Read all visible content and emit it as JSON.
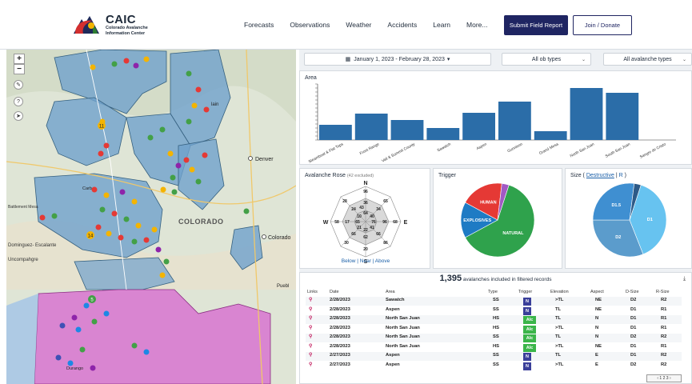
{
  "header": {
    "brand": "CAIC",
    "brand_sub": "Colorado Avalanche Information Center",
    "nav": [
      "Forecasts",
      "Observations",
      "Weather",
      "Accidents",
      "Learn",
      "More..."
    ],
    "submit_label": "Submit Field Report",
    "donate_label": "Join / Donate"
  },
  "map": {
    "zoom_in": "+",
    "zoom_out": "−",
    "labels": {
      "colorado": "COLORADO",
      "denver": "Denver",
      "co_springs": "Colorado",
      "pueblo": "Puebl",
      "battlement": "Battlement Mesa",
      "dominguez": "Dominguez-\nEscalante",
      "uncompahgre": "Uncompahgre",
      "durango": "Durango",
      "rifle": "Carb",
      "lain": "lain"
    },
    "colors": {
      "zone": "#6fa1cc",
      "south": "#d86fcf",
      "dot_red": "#e53935",
      "dot_yellow": "#f4b400",
      "dot_green": "#43a047",
      "dot_purple": "#8e24aa",
      "dot_blue": "#1e88e5"
    }
  },
  "filters": {
    "date_range": "January 1, 2023 - February 28, 2023",
    "ob_types": "All ob types",
    "avalanche_types": "All avalanche types"
  },
  "area_chart": {
    "title": "Area"
  },
  "chart_data": [
    {
      "type": "bar",
      "title": "Area",
      "categories": [
        "Steamboat & Flat Tops",
        "Front Range",
        "Vail & Summit County",
        "Sawatch",
        "Aspen",
        "Gunnison",
        "Grand Mesa",
        "North San Juan",
        "South San Juan",
        "Sangre de Cristo"
      ],
      "values": [
        95,
        165,
        125,
        75,
        170,
        240,
        55,
        325,
        295,
        0
      ],
      "ylim": [
        0,
        350
      ],
      "color": "#2b6da8"
    },
    {
      "type": "pie",
      "title": "Trigger",
      "labels": [
        "NATURAL",
        "EXPLOSIVES",
        "HUMAN",
        "OTHER"
      ],
      "values": [
        59,
        15,
        18,
        3
      ],
      "colors": [
        "#2fa24c",
        "#1e7bc4",
        "#e53935",
        "#a259c4"
      ]
    },
    {
      "type": "pie",
      "title": "Size ( Destructive | R )",
      "labels": [
        "D1",
        "D2",
        "D1.5",
        "D3"
      ],
      "values": [
        39,
        31,
        27,
        3
      ],
      "colors": [
        "#67c3f0",
        "#5b9ccc",
        "#3f8fd1",
        "#2d5a87"
      ]
    }
  ],
  "rose": {
    "title": "Avalanche Rose",
    "excluded": "(42 excluded)",
    "values": [
      "96",
      "36",
      "64",
      "65",
      "34",
      "40",
      "76",
      "96",
      "68",
      "41",
      "66",
      "86",
      "62",
      "22",
      "20",
      "30",
      "66",
      "21",
      "28",
      "24",
      "43",
      "58",
      "17",
      "65",
      "10",
      "24",
      "18",
      "30"
    ],
    "n": "N",
    "s": "S",
    "e": "E",
    "w": "W",
    "links": "Below | Near | Above"
  },
  "trigger": {
    "title": "Trigger"
  },
  "size": {
    "title_prefix": "Size (",
    "destructive": "Destructive",
    "sep": "|",
    "r": "R",
    "title_suffix": ")"
  },
  "table": {
    "count": "1,395",
    "count_suffix": "avalanches included in filtered records",
    "headers": [
      "Links",
      "Date",
      "Area",
      "Type",
      "Trigger",
      "Elevation",
      "Aspect",
      "D-Size",
      "R-Size"
    ],
    "rows": [
      {
        "date": "2/28/2023",
        "area": "Sawatch",
        "type": "SS",
        "trigger": "N",
        "tcolor": "#3a3f9a",
        "elev": ">TL",
        "aspect": "NE",
        "d": "D2",
        "r": "R2"
      },
      {
        "date": "2/28/2023",
        "area": "Aspen",
        "type": "SS",
        "trigger": "N",
        "tcolor": "#3a3f9a",
        "elev": "TL",
        "aspect": "NE",
        "d": "D1",
        "r": "R1"
      },
      {
        "date": "2/28/2023",
        "area": "North San Juan",
        "type": "HS",
        "trigger": "AIc",
        "tcolor": "#3bb54a",
        "elev": "TL",
        "aspect": "N",
        "d": "D1",
        "r": "R1"
      },
      {
        "date": "2/28/2023",
        "area": "North San Juan",
        "type": "HS",
        "trigger": "AIc",
        "tcolor": "#3bb54a",
        "elev": ">TL",
        "aspect": "N",
        "d": "D1",
        "r": "R1"
      },
      {
        "date": "2/28/2023",
        "area": "North San Juan",
        "type": "SS",
        "trigger": "AIc",
        "tcolor": "#3bb54a",
        "elev": "TL",
        "aspect": "N",
        "d": "D2",
        "r": "R2"
      },
      {
        "date": "2/28/2023",
        "area": "North San Juan",
        "type": "HS",
        "trigger": "AIc",
        "tcolor": "#3bb54a",
        "elev": ">TL",
        "aspect": "NE",
        "d": "D1",
        "r": "R1"
      },
      {
        "date": "2/27/2023",
        "area": "Aspen",
        "type": "SS",
        "trigger": "N",
        "tcolor": "#3a3f9a",
        "elev": "TL",
        "aspect": "E",
        "d": "D1",
        "r": "R2"
      },
      {
        "date": "2/27/2023",
        "area": "Aspen",
        "type": "SS",
        "trigger": "N",
        "tcolor": "#3a3f9a",
        "elev": ">TL",
        "aspect": "E",
        "d": "D2",
        "r": "R2"
      }
    ]
  }
}
